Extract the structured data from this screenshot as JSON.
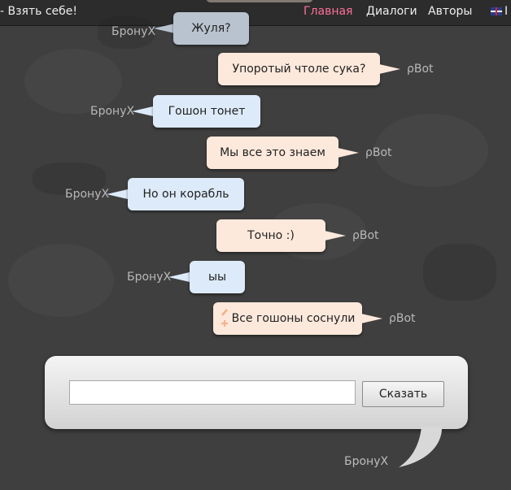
{
  "header": {
    "site_title": "- Взять себе!",
    "nav": [
      "Главная",
      "Диалоги",
      "Авторы"
    ],
    "lang_label": "I"
  },
  "chat": {
    "messages": [
      {
        "side": "left",
        "author": "БронуХ",
        "text": "Жуля?",
        "dim": true
      },
      {
        "side": "right",
        "author": "ρBot",
        "text": "Упоротый чтоле сука?"
      },
      {
        "side": "left",
        "author": "БронуХ",
        "text": "Гошон тонет"
      },
      {
        "side": "right",
        "author": "ρBot",
        "text": "Мы все это знаем"
      },
      {
        "side": "left",
        "author": "БронуХ",
        "text": "Но он корабль"
      },
      {
        "side": "right",
        "author": "ρBot",
        "text": "Точно :)"
      },
      {
        "side": "left",
        "author": "БронуХ",
        "text": "ыы"
      },
      {
        "side": "right",
        "author": "ρBot",
        "text": "Все гошоны соснули",
        "editable": true
      }
    ]
  },
  "compose": {
    "input_value": "",
    "button_label": "Сказать",
    "author": "БронуХ"
  },
  "colors": {
    "background": "#3f3f3f",
    "left_bubble": "#ddeaf9",
    "right_bubble": "#fde9dc",
    "nav_active": "#ff6f9b",
    "edit_icon": "#f4b48d"
  },
  "icons": [
    "uk-flag-icon",
    "edit-pencil-icon",
    "add-plus-icon"
  ]
}
